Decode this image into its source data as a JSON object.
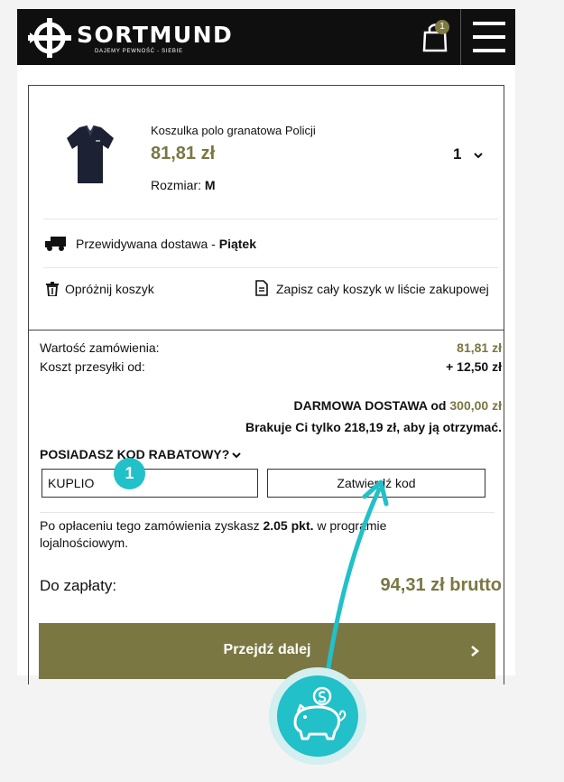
{
  "header": {
    "logo_text": "SORTMUND",
    "tagline": "DAJEMY PEWNOŚĆ - SIEBIE",
    "cart_count": "1"
  },
  "product": {
    "name": "Koszulka polo granatowa Policji",
    "price": "81,81 zł",
    "quantity": "1",
    "size_label": "Rozmiar:",
    "size_value": "M"
  },
  "delivery": {
    "label": "Przewidywana dostawa - ",
    "day": "Piątek"
  },
  "actions": {
    "empty_cart": "Opróżnij koszyk",
    "save_list": "Zapisz cały koszyk w liście zakupowej"
  },
  "summary": {
    "order_value_label": "Wartość zamówienia:",
    "order_value": "81,81 zł",
    "shipping_label": "Koszt przesyłki od:",
    "shipping_value": "+ 12,50 zł",
    "free_delivery_text": "DARMOWA DOSTAWA od ",
    "free_delivery_amount": "300,00 zł",
    "missing_text": "Brakuje Ci tylko 218,19 zł, aby ją otrzymać."
  },
  "discount": {
    "title": "POSIADASZ KOD RABATOWY?",
    "code_value": "KUPLIO",
    "apply_label": "Zatwierdź kod",
    "step_number": "1"
  },
  "loyalty": {
    "prefix": "Po opłaceniu tego zamówienia zyskasz ",
    "points": "2.05 pkt.",
    "suffix": " w programie lojalnościowym."
  },
  "total": {
    "label": "Do zapłaty:",
    "amount": "94,31 zł brutto"
  },
  "checkout": {
    "label": "Przejdź dalej"
  },
  "colors": {
    "accent_olive": "#7a7742",
    "header_black": "#0f0f0f",
    "teal": "#22c0c8"
  }
}
